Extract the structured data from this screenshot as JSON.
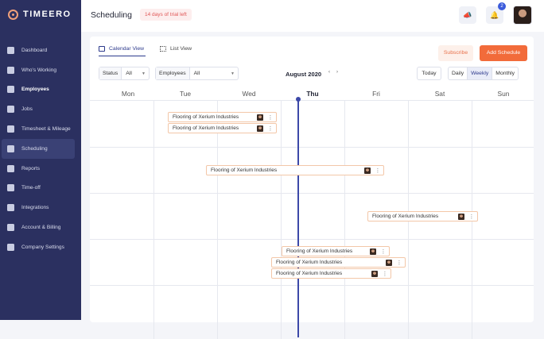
{
  "app": {
    "brand": "TIMEERO"
  },
  "sidebar": {
    "items": [
      {
        "label": "Dashboard",
        "icon": "dashboard-icon"
      },
      {
        "label": "Who's Working",
        "icon": "map-icon"
      },
      {
        "label": "Employees",
        "icon": "employees-icon"
      },
      {
        "label": "Jobs",
        "icon": "briefcase-icon"
      },
      {
        "label": "Timesheet & Mileage",
        "icon": "timesheet-icon"
      },
      {
        "label": "Scheduling",
        "icon": "calendar-icon"
      },
      {
        "label": "Reports",
        "icon": "reports-icon"
      },
      {
        "label": "Time-off",
        "icon": "time-off-icon"
      },
      {
        "label": "Integrations",
        "icon": "integrations-icon"
      },
      {
        "label": "Account & Billing",
        "icon": "billing-icon"
      },
      {
        "label": "Company Settings",
        "icon": "building-icon"
      }
    ]
  },
  "header": {
    "title": "Scheduling",
    "trial_badge": "14 days of trial left",
    "notification_count": "2"
  },
  "toolbar": {
    "calendar_view": "Calendar View",
    "list_view": "List View",
    "subscribe": "Subscribe",
    "add_schedule": "Add Schedule",
    "status_label": "Status",
    "status_value": "All",
    "employees_label": "Employees",
    "employees_value": "All",
    "month": "August 2020",
    "prev": "‹",
    "next": "›",
    "today": "Today",
    "daily": "Daily",
    "weekly": "Weekly",
    "monthly": "Monthly"
  },
  "calendar": {
    "days": [
      "Mon",
      "Tue",
      "Wed",
      "Thu",
      "Fri",
      "Sat",
      "Sun"
    ],
    "today": "Thu",
    "shift_name": "Flooring of Xerium Industries",
    "more": "⋮"
  },
  "colors": {
    "sidebar": "#2b3060",
    "accent": "#f26b3a",
    "primary": "#2d3a8c"
  }
}
